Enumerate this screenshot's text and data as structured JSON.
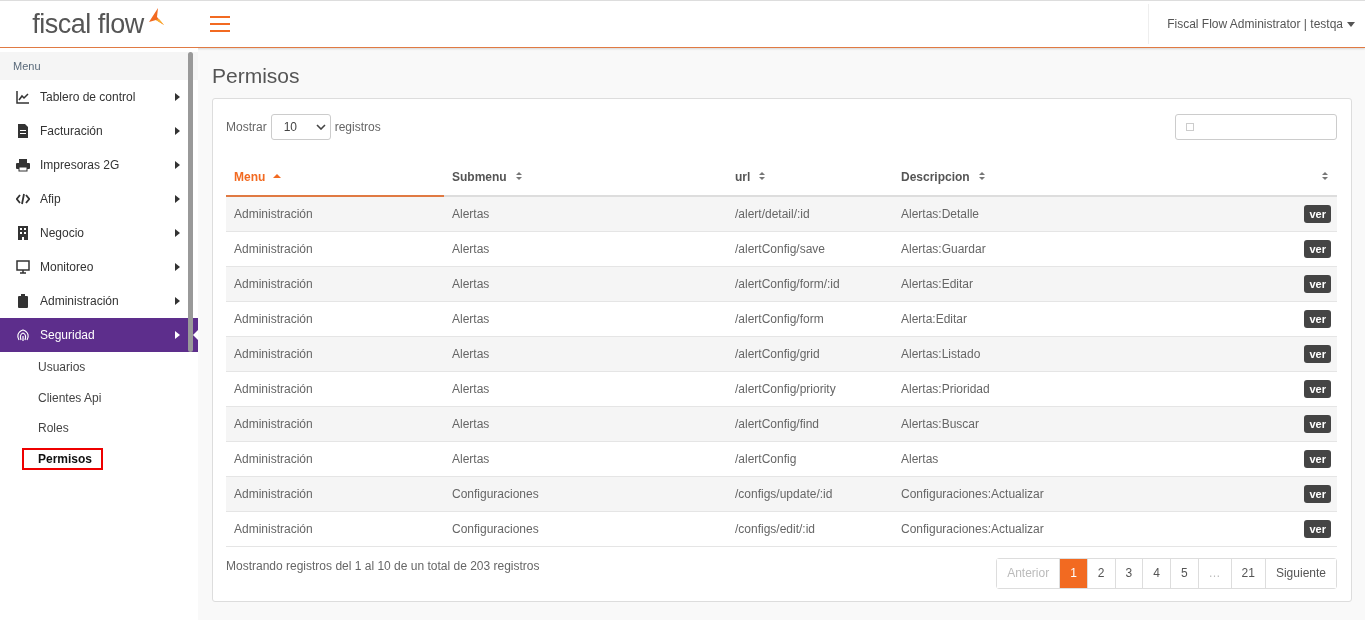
{
  "header": {
    "logo_text": "fiscal flow",
    "user_menu": "Fiscal Flow Administrator | testqa"
  },
  "sidebar": {
    "heading": "Menu",
    "items": [
      {
        "label": "Tablero de control",
        "selected": false
      },
      {
        "label": "Facturación",
        "selected": false
      },
      {
        "label": "Impresoras 2G",
        "selected": false
      },
      {
        "label": "Afip",
        "selected": false
      },
      {
        "label": "Negocio",
        "selected": false
      },
      {
        "label": "Monitoreo",
        "selected": false
      },
      {
        "label": "Administración",
        "selected": false
      },
      {
        "label": "Seguridad",
        "selected": true,
        "children": [
          {
            "label": "Usuarios",
            "selected": false
          },
          {
            "label": "Clientes Api",
            "selected": false
          },
          {
            "label": "Roles",
            "selected": false
          },
          {
            "label": "Permisos",
            "selected": true
          }
        ]
      }
    ]
  },
  "page_title": "Permisos",
  "length_control": {
    "label_before": "Mostrar",
    "value": "10",
    "label_after": "registros"
  },
  "table": {
    "columns": [
      {
        "label": "Menu",
        "selected": true
      },
      {
        "label": "Submenu",
        "selected": false
      },
      {
        "label": "url",
        "selected": false
      },
      {
        "label": "Descripcion",
        "selected": false
      },
      {
        "selected": false
      }
    ],
    "rows": [
      {
        "menu": "Administración",
        "submenu": "Alertas",
        "url": "/alert/detail/:id",
        "description": "Alertas:Detalle",
        "action": "ver"
      },
      {
        "menu": "Administración",
        "submenu": "Alertas",
        "url": "/alertConfig/save",
        "description": "Alertas:Guardar",
        "action": "ver"
      },
      {
        "menu": "Administración",
        "submenu": "Alertas",
        "url": "/alertConfig/form/:id",
        "description": "Alertas:Editar",
        "action": "ver"
      },
      {
        "menu": "Administración",
        "submenu": "Alertas",
        "url": "/alertConfig/form",
        "description": "Alerta:Editar",
        "action": "ver"
      },
      {
        "menu": "Administración",
        "submenu": "Alertas",
        "url": "/alertConfig/grid",
        "description": "Alertas:Listado",
        "action": "ver"
      },
      {
        "menu": "Administración",
        "submenu": "Alertas",
        "url": "/alertConfig/priority",
        "description": "Alertas:Prioridad",
        "action": "ver"
      },
      {
        "menu": "Administración",
        "submenu": "Alertas",
        "url": "/alertConfig/find",
        "description": "Alertas:Buscar",
        "action": "ver"
      },
      {
        "menu": "Administración",
        "submenu": "Alertas",
        "url": "/alertConfig",
        "description": "Alertas",
        "action": "ver"
      },
      {
        "menu": "Administración",
        "submenu": "Configuraciones",
        "url": "/configs/update/:id",
        "description": "Configuraciones:Actualizar",
        "action": "ver"
      },
      {
        "menu": "Administración",
        "submenu": "Configuraciones",
        "url": "/configs/edit/:id",
        "description": "Configuraciones:Actualizar",
        "action": "ver"
      }
    ]
  },
  "info": "Mostrando registros del 1 al 10 de un total de 203 registros",
  "pagination": [
    {
      "label": "Anterior",
      "selected": false,
      "disabled": true
    },
    {
      "label": "1",
      "selected": true,
      "disabled": false
    },
    {
      "label": "2",
      "selected": false,
      "disabled": false
    },
    {
      "label": "3",
      "selected": false,
      "disabled": false
    },
    {
      "label": "4",
      "selected": false,
      "disabled": false
    },
    {
      "label": "5",
      "selected": false,
      "disabled": false
    },
    {
      "label": "…",
      "selected": false,
      "disabled": true
    },
    {
      "label": "21",
      "selected": false,
      "disabled": false
    },
    {
      "label": "Siguiente",
      "selected": false,
      "disabled": false
    }
  ]
}
